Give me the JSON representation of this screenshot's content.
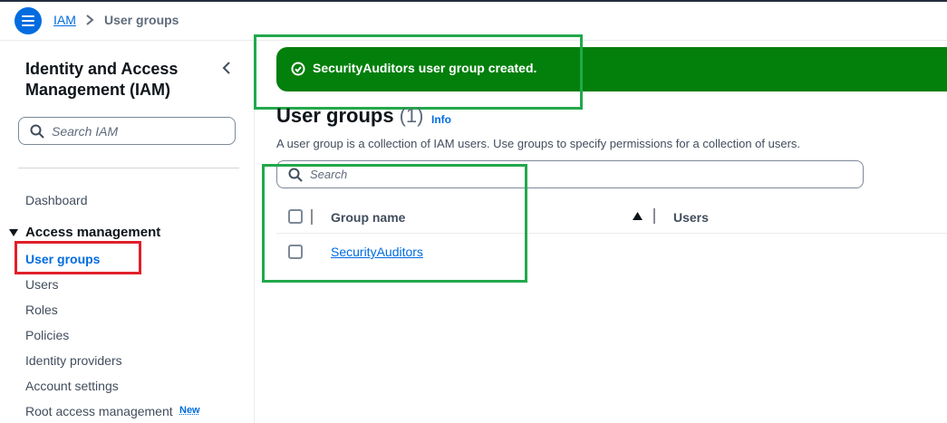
{
  "breadcrumb": {
    "root": "IAM",
    "current": "User groups"
  },
  "sidebar": {
    "title": "Identity and Access Management (IAM)",
    "search_placeholder": "Search IAM",
    "dashboard": "Dashboard",
    "section": "Access management",
    "items": [
      {
        "label": "User groups",
        "active": true
      },
      {
        "label": "Users",
        "active": false
      },
      {
        "label": "Roles",
        "active": false
      },
      {
        "label": "Policies",
        "active": false
      },
      {
        "label": "Identity providers",
        "active": false
      },
      {
        "label": "Account settings",
        "active": false
      },
      {
        "label": "Root access management",
        "active": false
      }
    ],
    "new_badge": "New"
  },
  "flash": {
    "message": "SecurityAuditors user group created."
  },
  "main": {
    "title": "User groups",
    "count": "(1)",
    "info": "Info",
    "description": "A user group is a collection of IAM users. Use groups to specify permissions for a collection of users.",
    "search_placeholder": "Search",
    "columns": {
      "group_name": "Group name",
      "users": "Users"
    },
    "rows": [
      {
        "group_name": "SecurityAuditors"
      }
    ]
  },
  "colors": {
    "accent": "#006ce0",
    "success": "#037f0c",
    "highlight_red": "#e0202a",
    "highlight_green": "#22a84b"
  },
  "icons": {
    "menu": "hamburger-icon",
    "breadcrumb_separator": "chevron-right-icon",
    "collapse": "chevron-left-icon",
    "search": "search-icon",
    "success": "check-circle-icon",
    "sort": "sort-ascending-icon",
    "expand": "caret-down-icon"
  }
}
